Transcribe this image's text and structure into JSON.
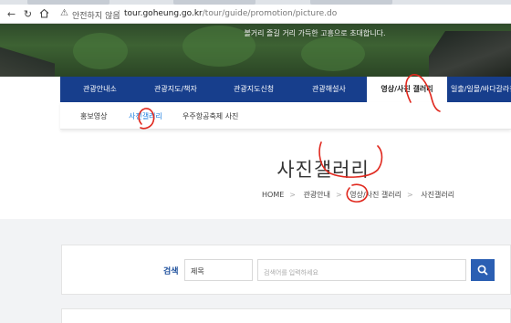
{
  "browser": {
    "warning": "안전하지 않음",
    "url_host": "tour.goheung.go.kr",
    "url_path": "/tour/guide/promotion/picture.do",
    "icons": [
      "back-icon",
      "forward-icon",
      "reload-icon",
      "home-icon",
      "warning-icon"
    ]
  },
  "hero": {
    "slogan": "볼거리 즐길 거리 가득한 고흥으로 초대합니다."
  },
  "main_nav": {
    "items": [
      "관광안내소",
      "관광지도/책자",
      "관광지도신청",
      "관광해설사",
      "영상/사진 갤러리",
      "일출/일몰/바다갈라짐"
    ],
    "active_index": 4
  },
  "sub_nav": {
    "items": [
      "홍보영상",
      "사진갤러리",
      "우주항공축제 사진"
    ],
    "active_index": 1
  },
  "page": {
    "title": "사진갤러리",
    "breadcrumb": [
      "HOME",
      "관광안내",
      "영상/사진 갤러리",
      "사진갤러리"
    ]
  },
  "search": {
    "label": "검색",
    "select_value": "제목",
    "placeholder": "검색어를 입력하세요",
    "button_icon": "search-icon"
  },
  "colors": {
    "nav_blue": "#173e8c",
    "accent": "#2b5fb3",
    "annotation_red": "#e0281e"
  }
}
